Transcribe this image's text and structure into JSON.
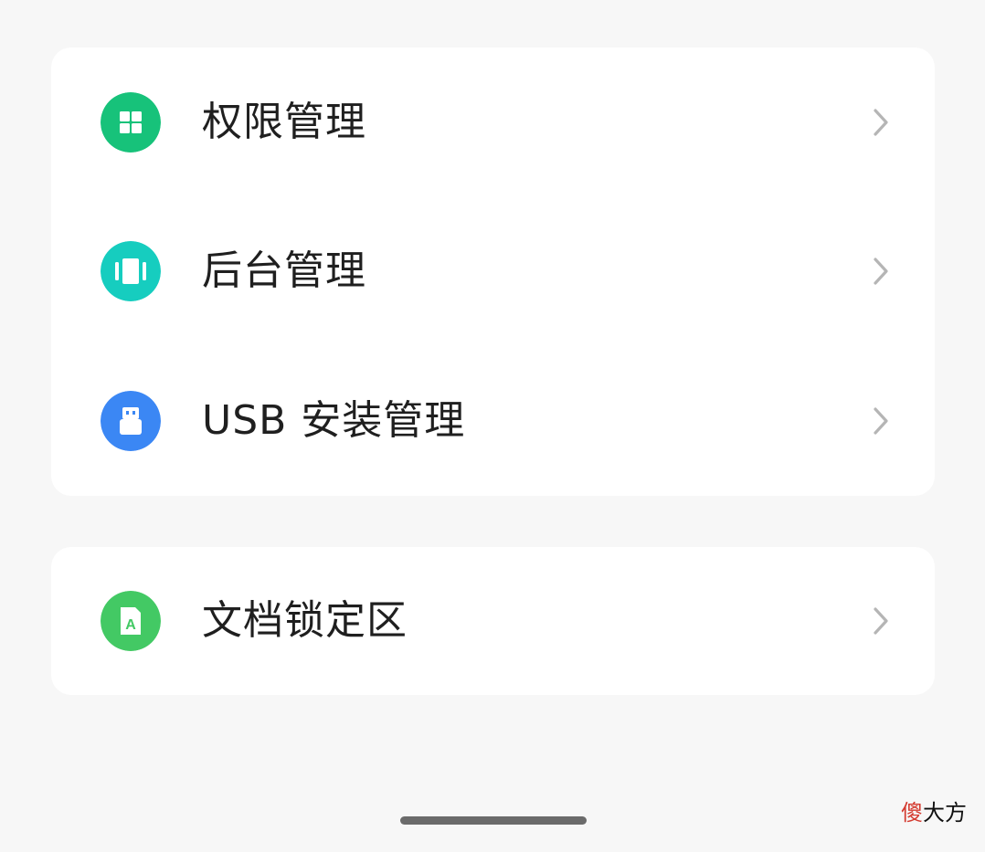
{
  "sections": [
    {
      "items": [
        {
          "label": "权限管理",
          "icon": "permission-grid-icon",
          "icon_color": "#17c27a"
        },
        {
          "label": "后台管理",
          "icon": "background-apps-icon",
          "icon_color": "#16cdbf"
        },
        {
          "label": "USB 安装管理",
          "icon": "usb-install-icon",
          "icon_color": "#3b87f4"
        }
      ]
    },
    {
      "items": [
        {
          "label": "文档锁定区",
          "icon": "document-lock-icon",
          "icon_color": "#43c964"
        }
      ]
    }
  ],
  "watermark": {
    "first": "傻",
    "rest": "大方",
    "first_color": "#d43a2f"
  }
}
